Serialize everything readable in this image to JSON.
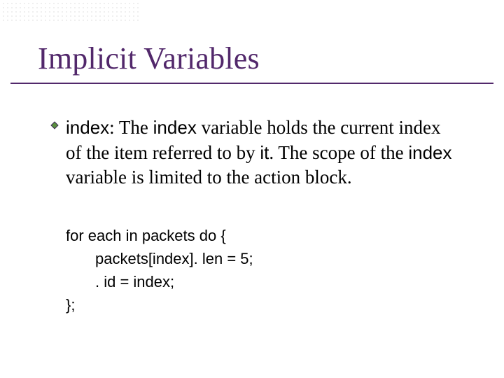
{
  "title": "Implicit Variables",
  "bullet": {
    "label": "index",
    "sep": ":  ",
    "p1": "The ",
    "kw1": "index",
    "p2": " variable holds the current index of the item referred to by ",
    "kw2": "it",
    "p3": ". The scope of the ",
    "kw3": "index",
    "p4": " variable is limited to the action block."
  },
  "code": {
    "line1": "for each in packets do {",
    "line2": "packets[index]. len = 5;",
    "line3": ". id = index;",
    "line4": "};"
  }
}
